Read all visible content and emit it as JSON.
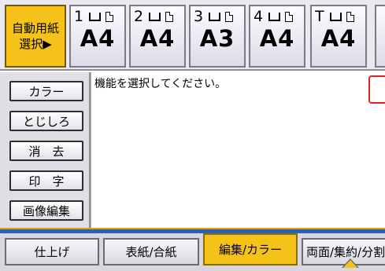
{
  "trays": {
    "auto": {
      "line1": "自動用紙",
      "line2": "選択▶"
    },
    "items": [
      {
        "label": "1",
        "size": "A4"
      },
      {
        "label": "2",
        "size": "A4"
      },
      {
        "label": "3",
        "size": "A3"
      },
      {
        "label": "4",
        "size": "A4"
      },
      {
        "label": "T",
        "size": "A4"
      }
    ]
  },
  "functions": [
    "カラー",
    "とじしろ",
    "消　去",
    "印　字",
    "画像編集"
  ],
  "message": "機能を選択してください。",
  "tabs": [
    "仕上げ",
    "表紙/合紙",
    "編集/カラー",
    "両面/集約/分割"
  ],
  "active_tab": "編集/カラー",
  "colors": {
    "accent": "#f5c21a",
    "strip": "#2b60b8"
  }
}
